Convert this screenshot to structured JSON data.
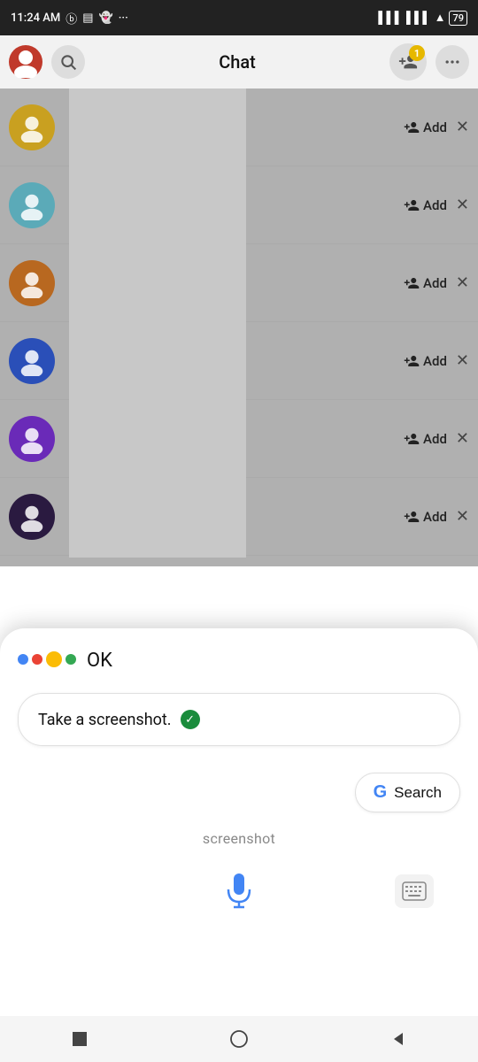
{
  "statusBar": {
    "time": "11:24 AM",
    "battery": "79"
  },
  "header": {
    "title": "Chat",
    "badge": "1",
    "addLabel": "+👤",
    "moreLabel": "···"
  },
  "chatList": {
    "items": [
      {
        "color": "#c9a020",
        "addLabel": "Add"
      },
      {
        "color": "#5baab8",
        "addLabel": "Add"
      },
      {
        "color": "#b86820",
        "addLabel": "Add"
      },
      {
        "color": "#2a4fb8",
        "addLabel": "Add"
      },
      {
        "color": "#6a2ab8",
        "addLabel": "Add"
      },
      {
        "color": "#2a1a40",
        "addLabel": "Add"
      }
    ]
  },
  "bottomSheet": {
    "okLabel": "OK",
    "bubbleText": "Take a screenshot.",
    "searchLabel": "Search",
    "transcriptText": "screenshot",
    "googleGLabel": "G"
  },
  "navBar": {
    "stopLabel": "■",
    "homeLabel": "○",
    "backLabel": "◀"
  }
}
